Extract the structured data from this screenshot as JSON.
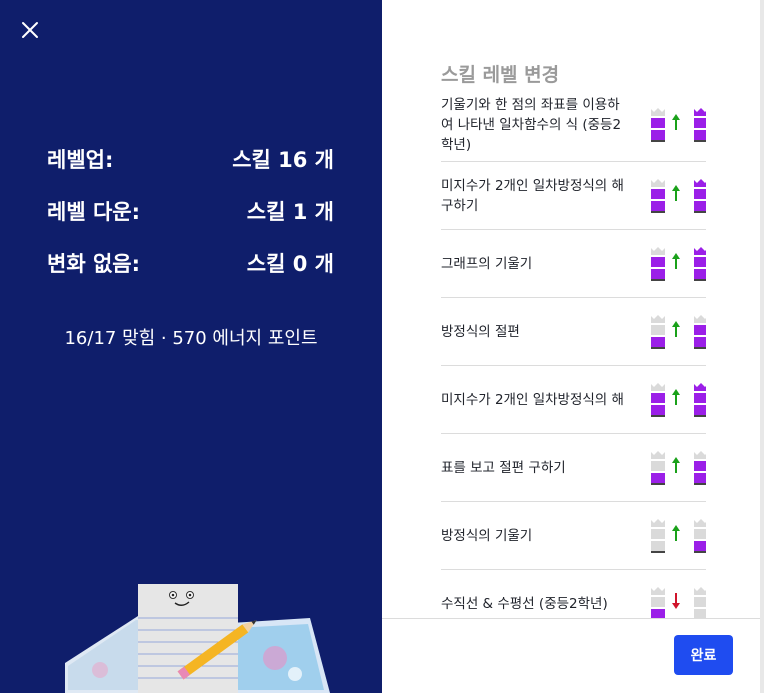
{
  "left": {
    "stats": [
      {
        "label": "레벨업:",
        "value": "스킬 16 개"
      },
      {
        "label": "레벨 다운:",
        "value": "스킬 1 개"
      },
      {
        "label": "변화 없음:",
        "value": "스킬 0 개"
      }
    ],
    "summary": "16/17 맞힘 · 570 에너지 포인트"
  },
  "right": {
    "title": "스킬 레벨 변경",
    "items": [
      {
        "label": "기울기와 한 점의 좌표를 이용하여 나타낸 일차함수의 식 (중등2학년)",
        "from_level": 2,
        "to_level": 3,
        "direction": "up"
      },
      {
        "label": "미지수가 2개인 일차방정식의 해 구하기",
        "from_level": 2,
        "to_level": 3,
        "direction": "up"
      },
      {
        "label": "그래프의 기울기",
        "from_level": 2,
        "to_level": 3,
        "direction": "up"
      },
      {
        "label": "방정식의 절편",
        "from_level": 1,
        "to_level": 2,
        "direction": "up"
      },
      {
        "label": "미지수가 2개인 일차방정식의 해",
        "from_level": 2,
        "to_level": 3,
        "direction": "up"
      },
      {
        "label": "표를 보고 절편 구하기",
        "from_level": 1,
        "to_level": 2,
        "direction": "up"
      },
      {
        "label": "방정식의 기울기",
        "from_level": 0,
        "to_level": 1,
        "direction": "up"
      },
      {
        "label": "수직선 & 수평선 (중등2학년)",
        "from_level": 1,
        "to_level": 0,
        "direction": "down"
      }
    ],
    "done_label": "완료"
  },
  "colors": {
    "left_bg": "#0f1e6b",
    "level_fill": "#9b1fe8",
    "level_empty": "#dadada",
    "arrow_up": "#1aa11a",
    "arrow_down": "#d0142b",
    "button": "#1f4cf0"
  }
}
